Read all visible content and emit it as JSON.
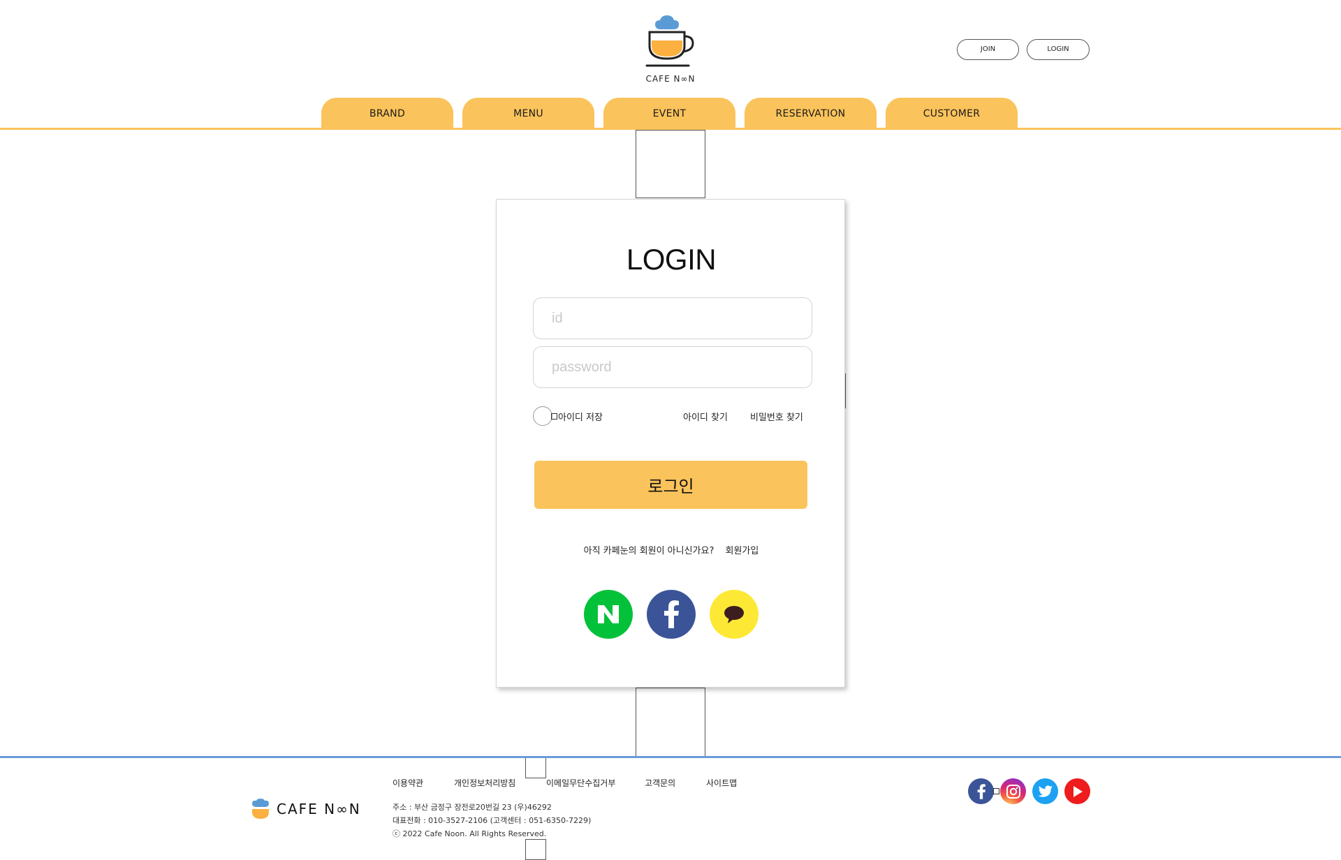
{
  "header": {
    "logo_text": "CAFE N∞N",
    "join_label": "JOIN",
    "login_label": "LOGIN"
  },
  "nav": {
    "tabs": [
      {
        "label": "BRAND"
      },
      {
        "label": "MENU"
      },
      {
        "label": "EVENT"
      },
      {
        "label": "RESERVATION"
      },
      {
        "label": "CUSTOMER"
      }
    ]
  },
  "login": {
    "title": "LOGIN",
    "id_placeholder": "id",
    "password_placeholder": "password",
    "save_id_label": "아이디 저장",
    "find_id_label": "아이디 찾기",
    "find_password_label": "비밀번호 찾기",
    "submit_label": "로그인",
    "signup_prompt": "아직 카페눈의 회원이 아니신가요?",
    "signup_link": "회원가입",
    "social": [
      "naver-icon",
      "facebook-icon",
      "kakao-icon"
    ]
  },
  "footer": {
    "logo_text": "CAFE N∞N",
    "links": [
      "이용약관",
      "개인정보처리방침",
      "이메일무단수집거부",
      "고객문의",
      "사이트맵"
    ],
    "address": "주소 : 부산 금정구 장전로20번길 23 (우)46292",
    "phone": "대표전화 : 010-3527-2106 (고객센터 : 051-6350-7229)",
    "copyright": "ⓒ 2022 Cafe Noon. All Rights Reserved.",
    "sns": [
      "facebook-icon",
      "instagram-icon",
      "twitter-icon",
      "youtube-icon"
    ]
  },
  "colors": {
    "accent": "#fbc35b",
    "footer_line": "#6a9bd7",
    "naver": "#03c139",
    "facebook": "#3b5498",
    "kakao": "#fde935"
  }
}
